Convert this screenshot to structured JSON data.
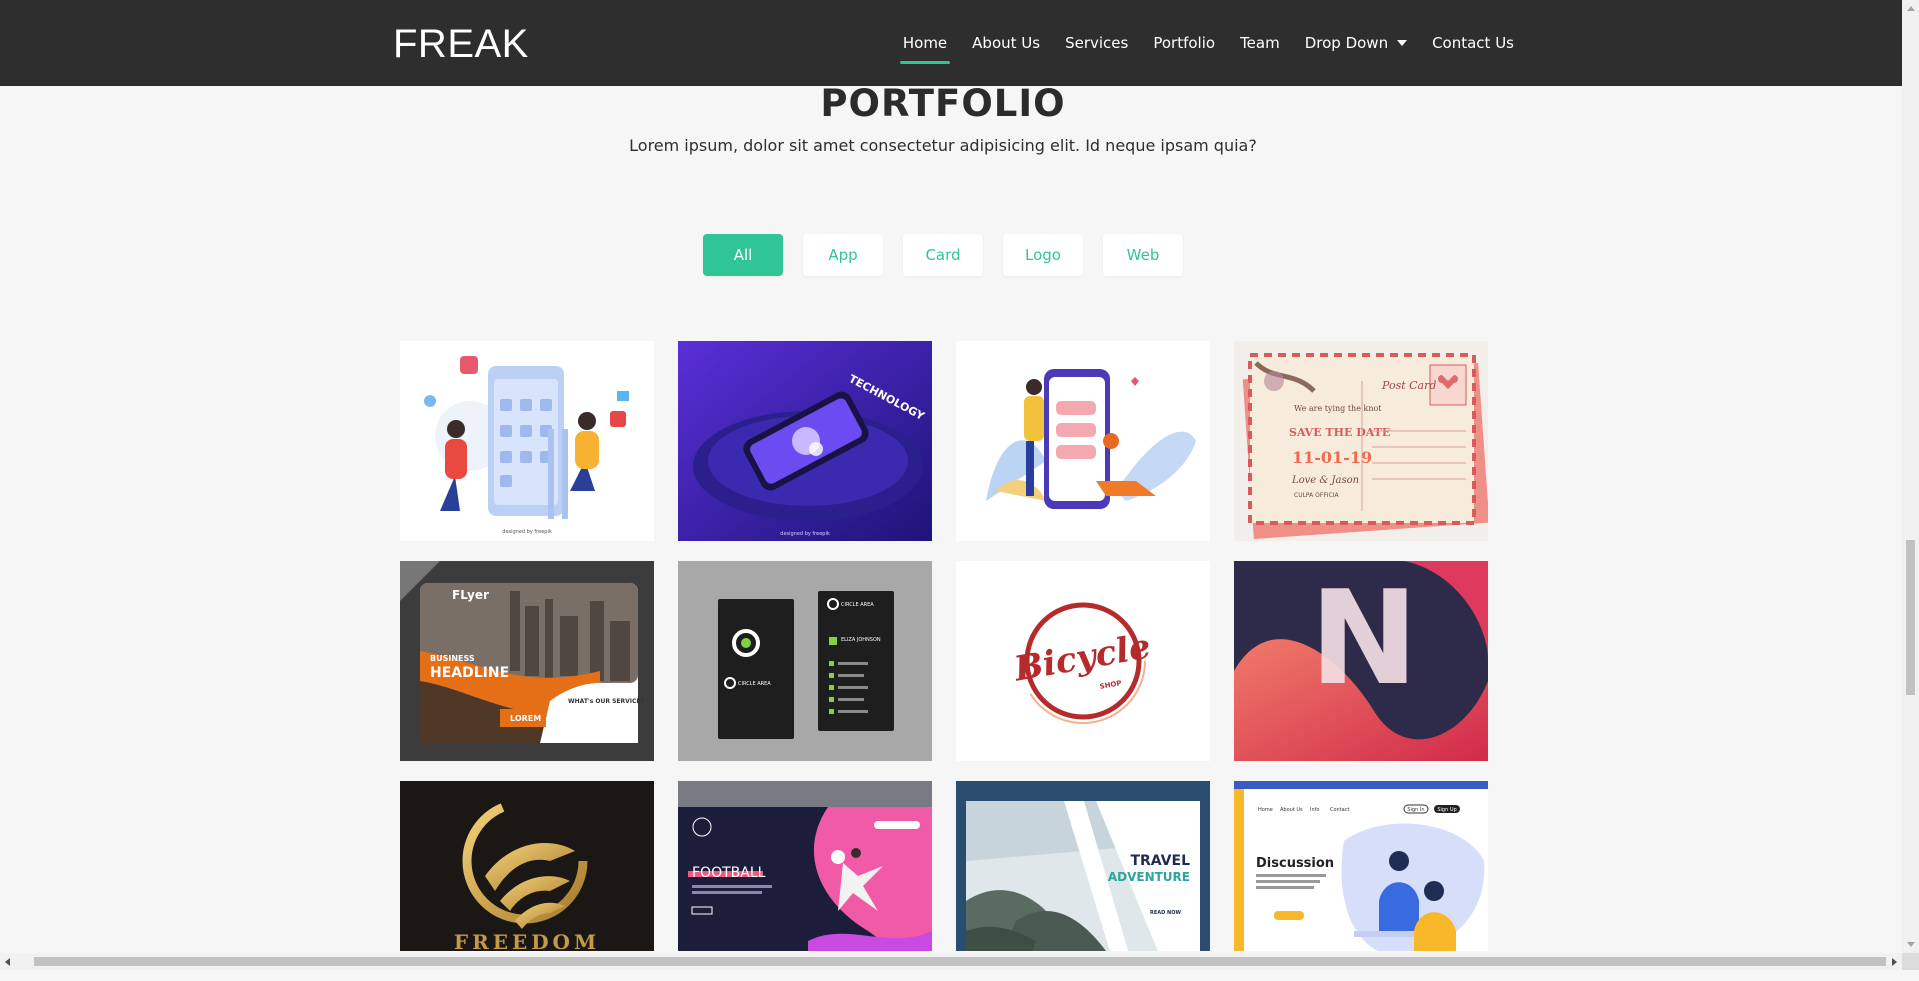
{
  "navbar": {
    "brand": "FREAK",
    "items": [
      {
        "label": "Home",
        "active": true
      },
      {
        "label": "About Us"
      },
      {
        "label": "Services"
      },
      {
        "label": "Portfolio"
      },
      {
        "label": "Team"
      },
      {
        "label": "Drop Down",
        "dropdown": true
      },
      {
        "label": "Contact Us"
      }
    ]
  },
  "portfolio": {
    "title": "PORTFOLIO",
    "subtitle": "Lorem ipsum, dolor sit amet consectetur adipisicing elit. Id neque ipsam quia?",
    "filters": [
      {
        "label": "All",
        "active": true
      },
      {
        "label": "App"
      },
      {
        "label": "Card"
      },
      {
        "label": "Logo"
      },
      {
        "label": "Web"
      }
    ],
    "items": [
      {
        "name": "social-media-app-illustration",
        "credit": "designed by freepik"
      },
      {
        "name": "technology-phone-illustration",
        "text": "TECHNOLOGY",
        "credit": "designed by freepik"
      },
      {
        "name": "chat-app-illustration"
      },
      {
        "name": "postcard-card",
        "text": [
          "Post Card",
          "SAVE THE DATE",
          "11-01-19",
          "Love & Jason",
          "CULPA OFFICIA"
        ]
      },
      {
        "name": "business-flyer-card",
        "text": [
          "FLyer",
          "BUSINESS",
          "HEADLINE",
          "WHAT's OUR SERVICE?",
          "LOREM"
        ]
      },
      {
        "name": "circle-area-business-card",
        "text": [
          "CIRCLE AREA",
          "ELIZA JOHNSON"
        ]
      },
      {
        "name": "bicycle-shop-logo",
        "text": [
          "Bicycle",
          "SHOP"
        ]
      },
      {
        "name": "n-letter-logo",
        "text": "N"
      },
      {
        "name": "freedom-logo",
        "text": "FREEDOM"
      },
      {
        "name": "football-web",
        "text": "FOOTBALL"
      },
      {
        "name": "travel-adventure-web",
        "text": [
          "TRAVEL",
          "ADVENTURE",
          "READ NOW"
        ]
      },
      {
        "name": "discussion-web",
        "text": [
          "Discussion",
          "Home",
          "About Us",
          "Info",
          "Contact",
          "Sign In",
          "Sign Up"
        ]
      }
    ]
  },
  "colors": {
    "accent": "#2fc596",
    "navbar": "#2e2e2e",
    "page": "#f6f6f6"
  }
}
